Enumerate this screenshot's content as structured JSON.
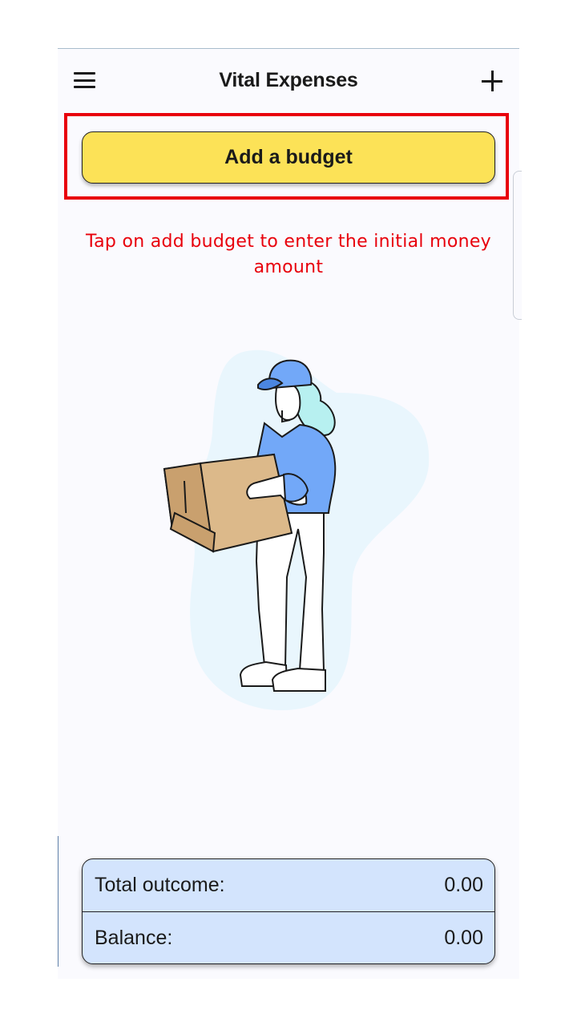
{
  "app": {
    "title": "Vital Expenses"
  },
  "header": {
    "menu_icon": "hamburger-menu-icon",
    "add_icon": "plus-icon"
  },
  "budget": {
    "button_label": "Add a budget"
  },
  "hint": {
    "text": "Tap on add budget to enter the initial money amount"
  },
  "summary": {
    "rows": [
      {
        "label": "Total outcome:",
        "value": "0.00"
      },
      {
        "label": "Balance:",
        "value": "0.00"
      }
    ]
  },
  "colors": {
    "accent_yellow": "#fce257",
    "hint_red": "#e8000b",
    "summary_blue": "#d3e4fd"
  }
}
